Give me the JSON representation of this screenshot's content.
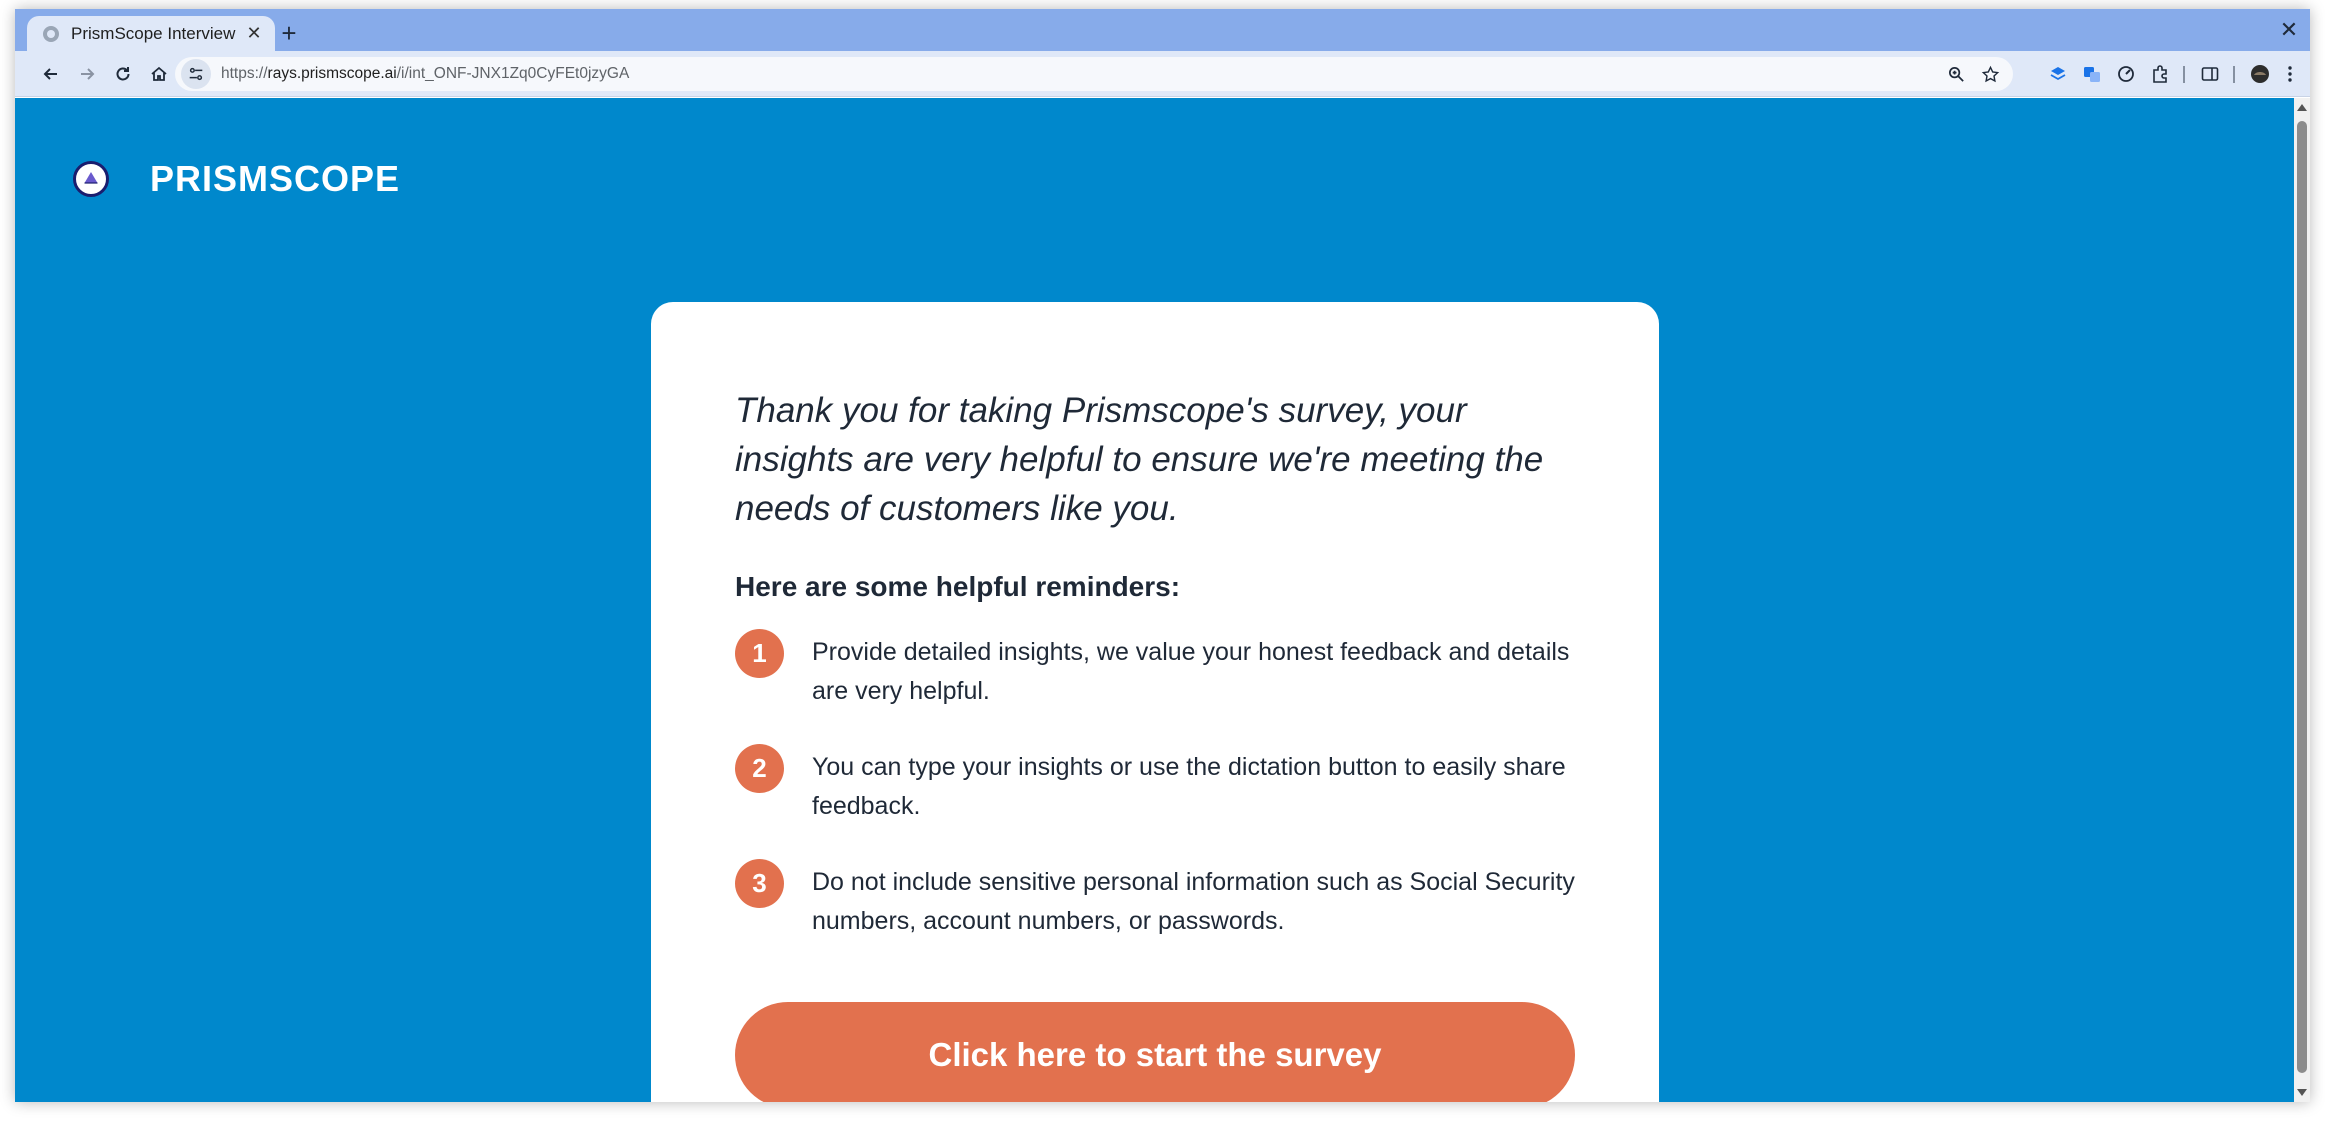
{
  "browser": {
    "tab_title": "PrismScope Interview",
    "url_prefix": "https://",
    "url_host": "rays.prismscope.ai",
    "url_path": "/i/int_ONF-JNX1Zq0CyFEt0jzyGA"
  },
  "header": {
    "brand_name": "PRISMSCOPE"
  },
  "card": {
    "intro": "Thank you for taking Prismscope's survey, your insights are very helpful to ensure we're meeting the needs of customers like you.",
    "reminders_heading": "Here are some helpful reminders:",
    "reminders": [
      {
        "number": "1",
        "text": "Provide detailed insights, we value your honest feedback and details are very helpful."
      },
      {
        "number": "2",
        "text": "You can type your insights or use the dictation button to easily share feedback."
      },
      {
        "number": "3",
        "text": "Do not include sensitive personal information such as Social Security numbers, account numbers, or passwords."
      }
    ],
    "start_button_label": "Click here to start the survey"
  },
  "colors": {
    "page_background": "#0088cc",
    "accent": "#e2714e",
    "tabstrip": "#87abea",
    "toolbar": "#dfe8f8"
  }
}
